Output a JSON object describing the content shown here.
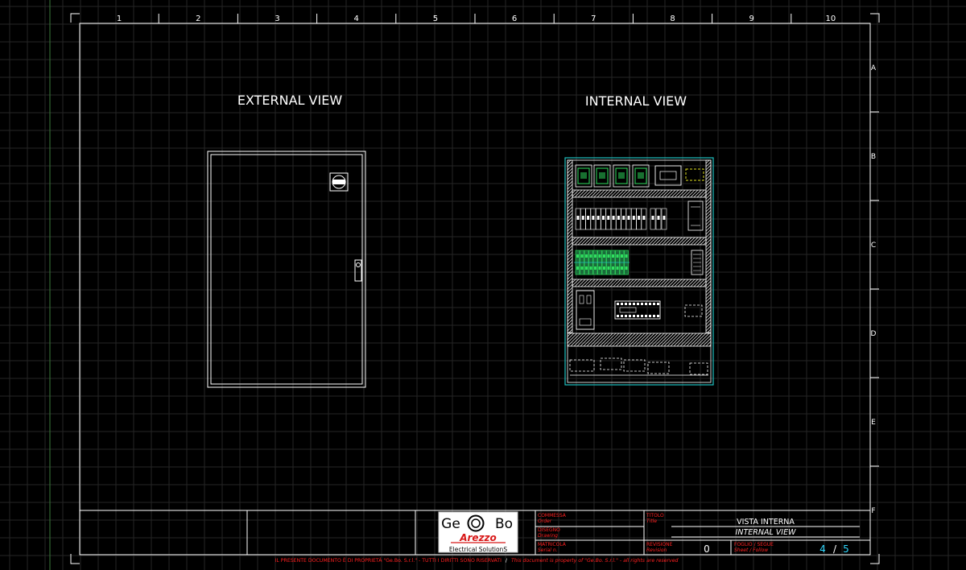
{
  "drawing": {
    "column_labels": [
      "1",
      "2",
      "3",
      "4",
      "5",
      "6",
      "7",
      "8",
      "9",
      "10"
    ],
    "row_labels": [
      "A",
      "B",
      "C",
      "D",
      "E",
      "F"
    ],
    "view_titles": {
      "external": "EXTERNAL VIEW",
      "internal": "INTERNAL VIEW"
    }
  },
  "title_block": {
    "logo": {
      "left": "Ge",
      "right": "Bo",
      "city": "Arezzo",
      "tagline": "Electrical SolutionS"
    },
    "order_label": "COMMESSA",
    "order_label_en": "Order",
    "drawing_label": "DISEGNO",
    "drawing_label_en": "Drawing",
    "serial_label": "MATRICOLA",
    "serial_label_en": "Serial n.",
    "title_label": "TITOLO",
    "title_label_en": "Title",
    "title_it": "VISTA INTERNA",
    "title_en": "INTERNAL VIEW",
    "revision_label": "REVISIONE",
    "revision_label_en": "Revision",
    "revision_value": "0",
    "sheet_label": "FOGLIO / SEGUE",
    "sheet_label_en": "Sheet / Follow",
    "sheet_current": "4",
    "sheet_sep": "/",
    "sheet_total": "5"
  },
  "footer": {
    "ownership_it": "IL PRESENTE DOCUMENTO È DI PROPRIETÀ \"Ge.Bo. S.r.l.\" - TUTTI I DIRITTI SONO RISERVATI",
    "slash": "/",
    "ownership_en": "This document is property of \"Ge.Bo. S.r.l.\" - all rights are reserved"
  },
  "colors": {
    "background": "#000000",
    "grid": "#2e2e2e",
    "lines": "#ffffff",
    "cabinet_outline": "#20c0c0",
    "label_red": "#ff2020",
    "sheet_cyan": "#30d8ff",
    "terminal_green": "#30e060",
    "accent_yellow": "#e0e020"
  }
}
